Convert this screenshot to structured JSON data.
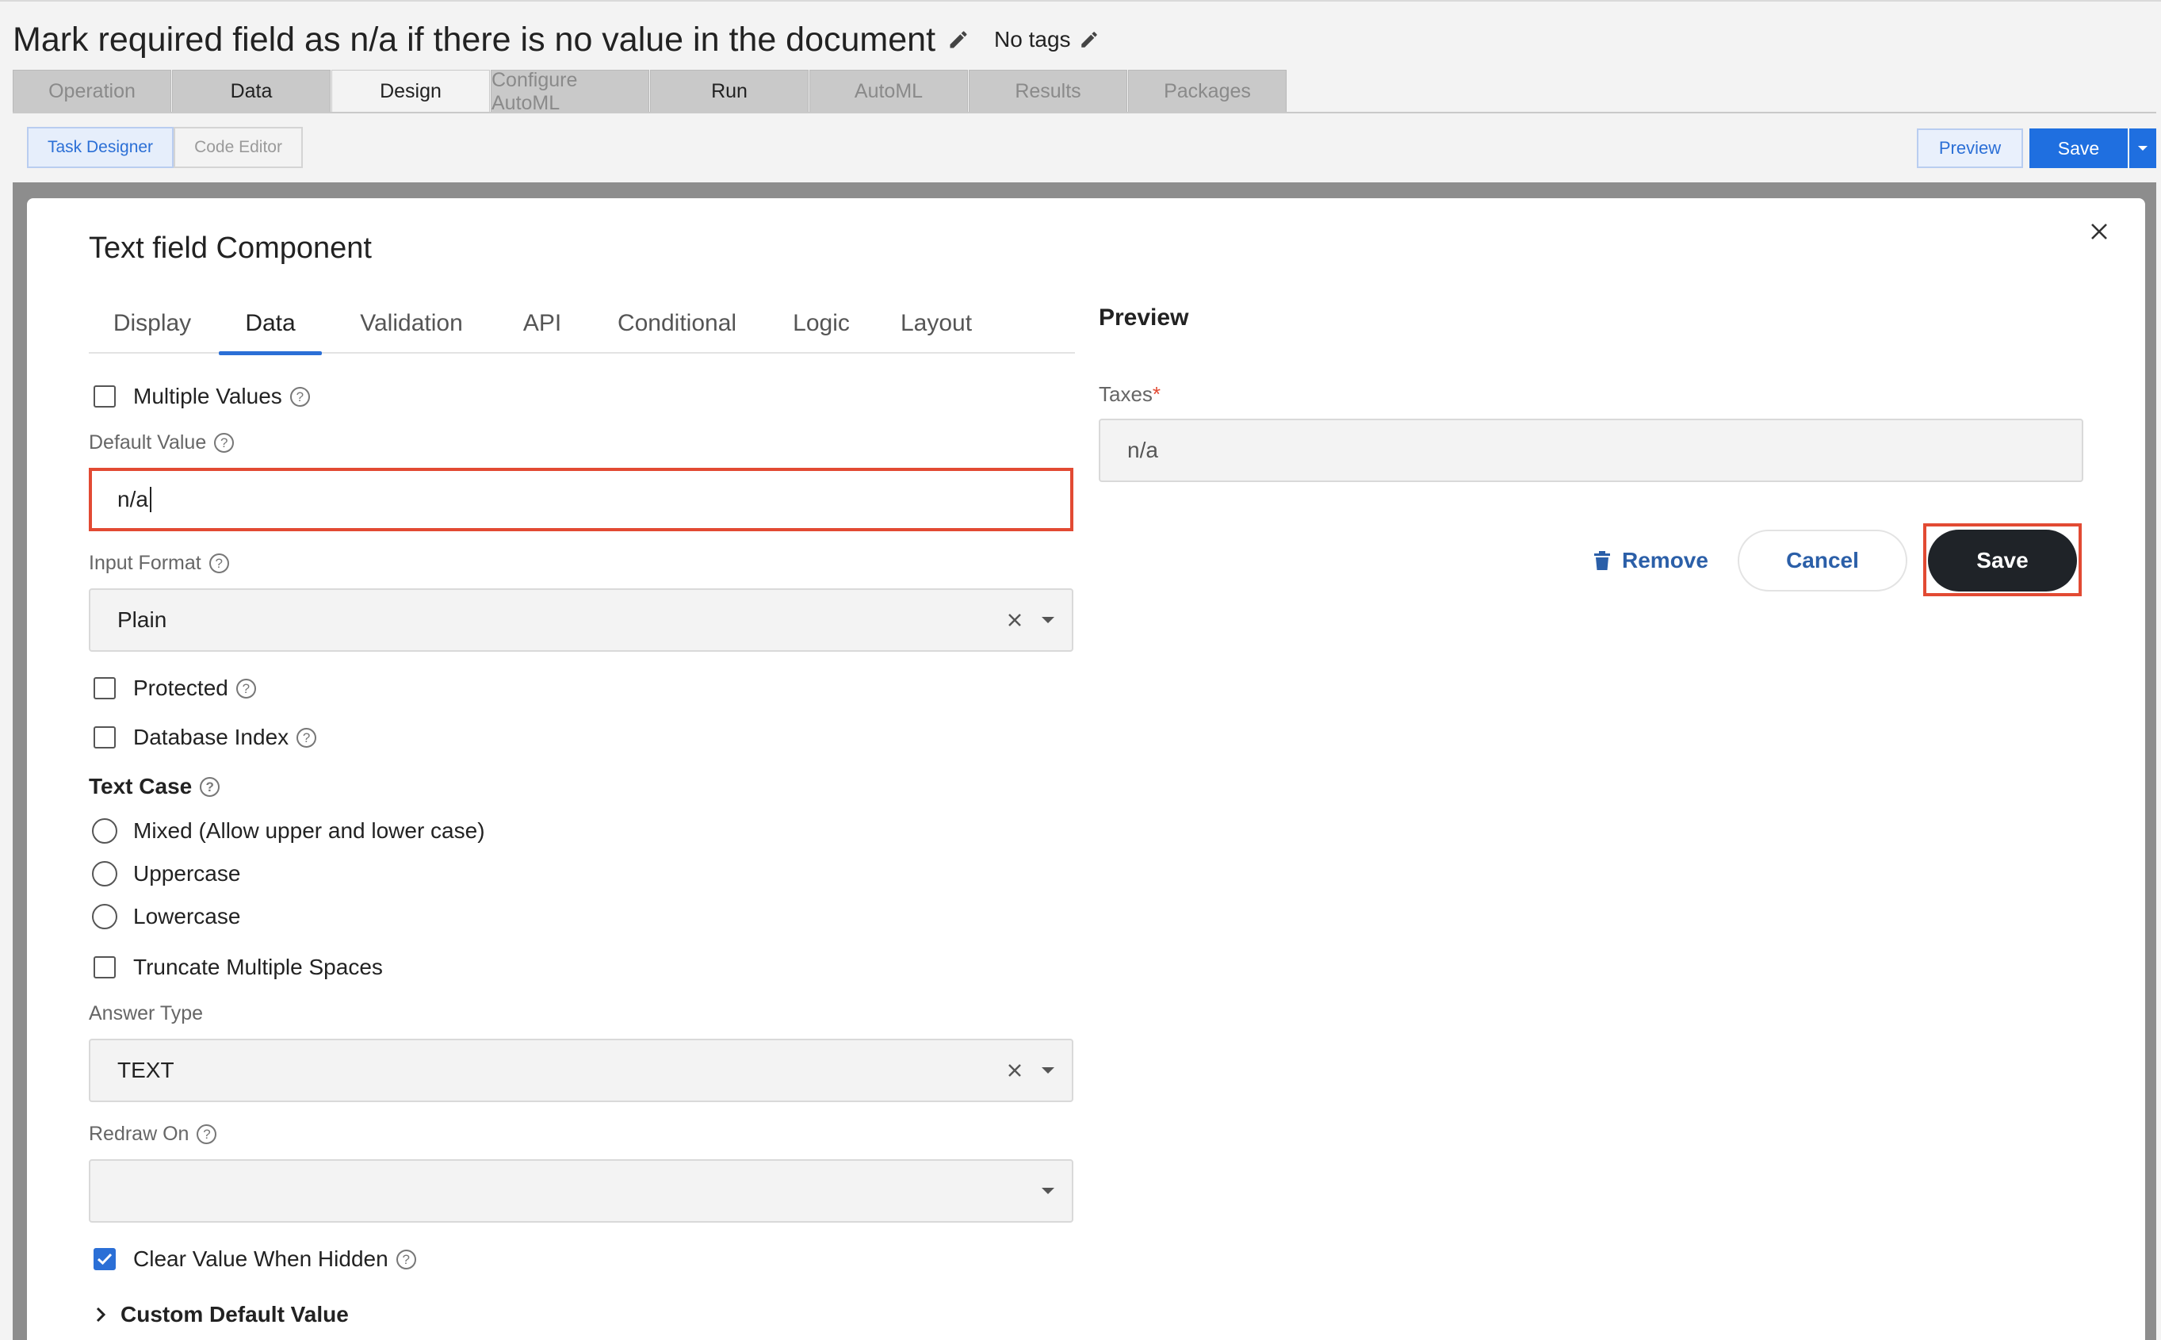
{
  "header": {
    "title": "Mark required field as n/a if there is no value in the document",
    "tags_label": "No tags"
  },
  "main_tabs": [
    {
      "label": "Operation",
      "state": "disabled"
    },
    {
      "label": "Data",
      "state": "enabled"
    },
    {
      "label": "Design",
      "state": "active"
    },
    {
      "label": "Configure AutoML",
      "state": "disabled"
    },
    {
      "label": "Run",
      "state": "enabled"
    },
    {
      "label": "AutoML",
      "state": "disabled"
    },
    {
      "label": "Results",
      "state": "disabled"
    },
    {
      "label": "Packages",
      "state": "disabled"
    }
  ],
  "sub_tabs": [
    {
      "label": "Task Designer",
      "active": true
    },
    {
      "label": "Code Editor",
      "active": false
    }
  ],
  "toolbar": {
    "preview_label": "Preview",
    "save_label": "Save"
  },
  "modal": {
    "title": "Text field Component",
    "tabs": [
      {
        "label": "Display",
        "active": false
      },
      {
        "label": "Data",
        "active": true
      },
      {
        "label": "Validation",
        "active": false
      },
      {
        "label": "API",
        "active": false
      },
      {
        "label": "Conditional",
        "active": false
      },
      {
        "label": "Logic",
        "active": false
      },
      {
        "label": "Layout",
        "active": false
      }
    ],
    "form": {
      "multiple_values_label": "Multiple Values",
      "multiple_values_checked": false,
      "default_value_label": "Default Value",
      "default_value": "n/a",
      "input_format_label": "Input Format",
      "input_format_value": "Plain",
      "protected_label": "Protected",
      "protected_checked": false,
      "database_index_label": "Database Index",
      "database_index_checked": false,
      "text_case_label": "Text Case",
      "text_case_options": [
        "Mixed (Allow upper and lower case)",
        "Uppercase",
        "Lowercase"
      ],
      "truncate_label": "Truncate Multiple Spaces",
      "truncate_checked": false,
      "answer_type_label": "Answer Type",
      "answer_type_value": "TEXT",
      "redraw_on_label": "Redraw On",
      "redraw_on_value": "",
      "clear_value_label": "Clear Value When Hidden",
      "clear_value_checked": true,
      "custom_default_label": "Custom Default Value"
    },
    "preview": {
      "title": "Preview",
      "field_label": "Taxes",
      "required_marker": "*",
      "field_value": "n/a"
    },
    "actions": {
      "remove_label": "Remove",
      "cancel_label": "Cancel",
      "save_label": "Save"
    }
  },
  "colors": {
    "accent": "#2b6fd6",
    "highlight": "#e24a33",
    "save_dark": "#1f2328"
  }
}
